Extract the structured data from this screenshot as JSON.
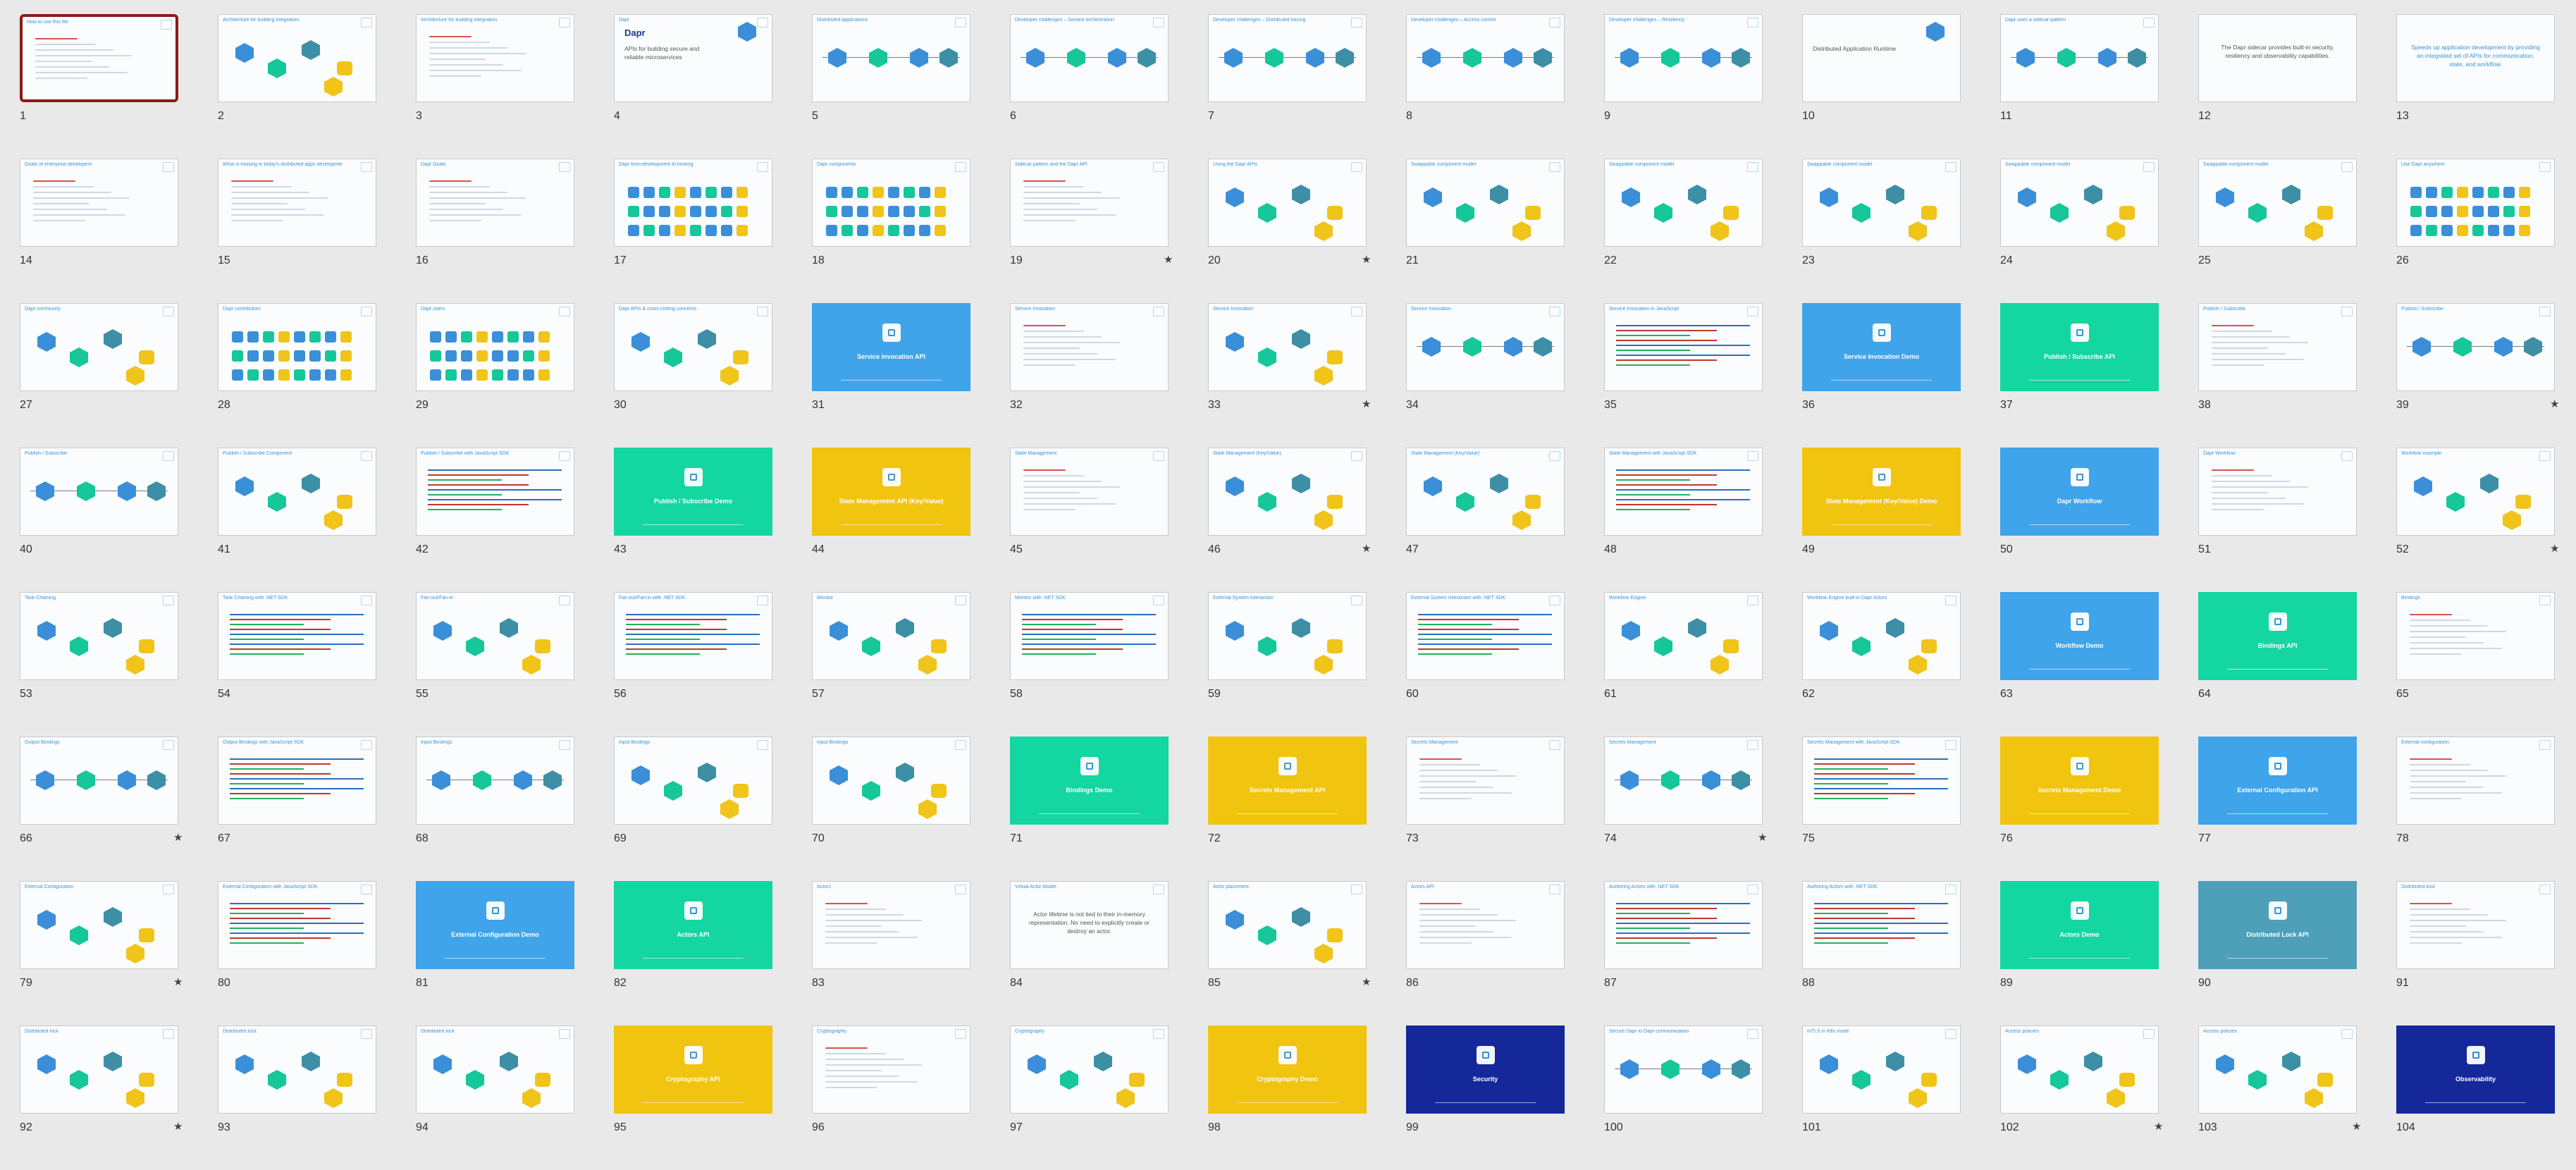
{
  "slides": [
    {
      "n": "1",
      "title": "How to use this file",
      "kind": "text",
      "selected": true,
      "star": false
    },
    {
      "n": "2",
      "title": "Architecture for building integration",
      "kind": "diagram",
      "star": false
    },
    {
      "n": "3",
      "title": "Architecture for building integration",
      "kind": "text",
      "star": false
    },
    {
      "n": "4",
      "title": "Dapr",
      "kind": "cover",
      "body": "APIs for building secure and reliable microservices",
      "star": false
    },
    {
      "n": "5",
      "title": "Distributed applications",
      "kind": "flow",
      "star": false
    },
    {
      "n": "6",
      "title": "Developer challenges – Service orchestration",
      "kind": "flow",
      "star": false
    },
    {
      "n": "7",
      "title": "Developer challenges – Distributed tracing",
      "kind": "flow",
      "star": false
    },
    {
      "n": "8",
      "title": "Developer challenges – Access control",
      "kind": "flow",
      "star": false
    },
    {
      "n": "9",
      "title": "Developer challenges – Resiliency",
      "kind": "flow",
      "star": false
    },
    {
      "n": "10",
      "title": "",
      "kind": "cover",
      "body": "Distributed Application Runtime",
      "star": false
    },
    {
      "n": "11",
      "title": "Dapr uses a sidecar pattern",
      "kind": "flow",
      "star": false
    },
    {
      "n": "12",
      "title": "",
      "kind": "center",
      "body": "The Dapr sidecar provides built-in security, resiliency and observability capabilities.",
      "star": false
    },
    {
      "n": "13",
      "title": "",
      "kind": "center-blue",
      "body": "Speeds up application development by providing an integrated set of APIs for communication, state, and workflow.",
      "star": false
    },
    {
      "n": "14",
      "title": "Goals of enterprise developers",
      "kind": "text",
      "star": false
    },
    {
      "n": "15",
      "title": "What is missing in today's distributed apps development?",
      "kind": "text",
      "star": false
    },
    {
      "n": "16",
      "title": "Dapr Goals",
      "kind": "text",
      "star": false
    },
    {
      "n": "17",
      "title": "Dapr from development to hosting",
      "kind": "grid",
      "star": false
    },
    {
      "n": "18",
      "title": "Dapr components",
      "kind": "grid",
      "star": false
    },
    {
      "n": "19",
      "title": "Sidecar pattern and the Dapr API",
      "kind": "text",
      "star": true
    },
    {
      "n": "20",
      "title": "Using the Dapr APIs",
      "kind": "diagram",
      "star": true
    },
    {
      "n": "21",
      "title": "Swappable component model",
      "kind": "diagram",
      "star": false
    },
    {
      "n": "22",
      "title": "Swappable component model",
      "kind": "diagram",
      "star": false
    },
    {
      "n": "23",
      "title": "Swappable component model",
      "kind": "diagram",
      "star": false
    },
    {
      "n": "24",
      "title": "Swappable component model",
      "kind": "diagram",
      "star": false
    },
    {
      "n": "25",
      "title": "Swappable component model",
      "kind": "diagram",
      "star": false
    },
    {
      "n": "26",
      "title": "Use Dapr anywhere",
      "kind": "grid",
      "star": false
    },
    {
      "n": "27",
      "title": "Dapr community",
      "kind": "diagram",
      "star": false
    },
    {
      "n": "28",
      "title": "Dapr contributors",
      "kind": "grid",
      "star": false
    },
    {
      "n": "29",
      "title": "Dapr users",
      "kind": "grid",
      "star": false
    },
    {
      "n": "30",
      "title": "Dapr APIs & cross-cutting concerns",
      "kind": "diagram",
      "star": false
    },
    {
      "n": "31",
      "title": "Service Invocation API",
      "kind": "section",
      "color": "blue",
      "star": false
    },
    {
      "n": "32",
      "title": "Service Invocation",
      "kind": "text",
      "star": false
    },
    {
      "n": "33",
      "title": "Service Invocation",
      "kind": "diagram",
      "star": true
    },
    {
      "n": "34",
      "title": "Service Invocation",
      "kind": "flow",
      "star": false
    },
    {
      "n": "35",
      "title": "Service Invocation in JavaScript",
      "kind": "code",
      "star": false
    },
    {
      "n": "36",
      "title": "Service Invocation Demo",
      "kind": "section",
      "color": "blue",
      "star": false
    },
    {
      "n": "37",
      "title": "Publish / Subscribe API",
      "kind": "section",
      "color": "green",
      "star": false
    },
    {
      "n": "38",
      "title": "Publish / Subscribe",
      "kind": "text",
      "star": false
    },
    {
      "n": "39",
      "title": "Publish / Subscribe",
      "kind": "flow",
      "star": true
    },
    {
      "n": "40",
      "title": "Publish / Subscribe",
      "kind": "flow",
      "star": false
    },
    {
      "n": "41",
      "title": "Publish / Subscribe Component",
      "kind": "diagram",
      "star": false
    },
    {
      "n": "42",
      "title": "Publish / Subscribe with JavaScript SDK",
      "kind": "code",
      "star": false
    },
    {
      "n": "43",
      "title": "Publish / Subscribe Demo",
      "kind": "section",
      "color": "green",
      "star": false
    },
    {
      "n": "44",
      "title": "State Management API (Key/Value)",
      "kind": "section",
      "color": "yellow",
      "star": false
    },
    {
      "n": "45",
      "title": "State Management",
      "kind": "text",
      "star": false
    },
    {
      "n": "46",
      "title": "State Management (Key/Value)",
      "kind": "diagram",
      "star": true
    },
    {
      "n": "47",
      "title": "State Management (Key/Value)",
      "kind": "diagram",
      "star": false
    },
    {
      "n": "48",
      "title": "State Management with JavaScript SDK",
      "kind": "code",
      "star": false
    },
    {
      "n": "49",
      "title": "State Management (Key/Value) Demo",
      "kind": "section",
      "color": "yellow",
      "star": false
    },
    {
      "n": "50",
      "title": "Dapr Workflow",
      "kind": "section",
      "color": "blue",
      "star": false
    },
    {
      "n": "51",
      "title": "Dapr Workflow",
      "kind": "text",
      "star": false
    },
    {
      "n": "52",
      "title": "Workflow example",
      "kind": "diagram",
      "star": true
    },
    {
      "n": "53",
      "title": "Task Chaining",
      "kind": "diagram",
      "star": false
    },
    {
      "n": "54",
      "title": "Task Chaining with .NET SDK",
      "kind": "code",
      "star": false
    },
    {
      "n": "55",
      "title": "Fan-out/Fan-in",
      "kind": "diagram",
      "star": false
    },
    {
      "n": "56",
      "title": "Fan-out/Fan-in with .NET SDK",
      "kind": "code",
      "star": false
    },
    {
      "n": "57",
      "title": "Monitor",
      "kind": "diagram",
      "star": false
    },
    {
      "n": "58",
      "title": "Monitor with .NET SDK",
      "kind": "code",
      "star": false
    },
    {
      "n": "59",
      "title": "External System Interaction",
      "kind": "diagram",
      "star": false
    },
    {
      "n": "60",
      "title": "External System Interaction with .NET SDK",
      "kind": "code",
      "star": false
    },
    {
      "n": "61",
      "title": "Workflow Engine",
      "kind": "diagram",
      "star": false
    },
    {
      "n": "62",
      "title": "Workflow Engine built-in Dapr Actors",
      "kind": "diagram",
      "star": false
    },
    {
      "n": "63",
      "title": "Workflow Demo",
      "kind": "section",
      "color": "blue",
      "star": false
    },
    {
      "n": "64",
      "title": "Bindings API",
      "kind": "section",
      "color": "green",
      "star": false
    },
    {
      "n": "65",
      "title": "Bindings",
      "kind": "text",
      "star": false
    },
    {
      "n": "66",
      "title": "Output Bindings",
      "kind": "flow",
      "star": true
    },
    {
      "n": "67",
      "title": "Output Bindings with JavaScript SDK",
      "kind": "code",
      "star": false
    },
    {
      "n": "68",
      "title": "Input Bindings",
      "kind": "flow",
      "star": false
    },
    {
      "n": "69",
      "title": "Input Bindings",
      "kind": "diagram",
      "star": false
    },
    {
      "n": "70",
      "title": "Input Bindings",
      "kind": "diagram",
      "star": false
    },
    {
      "n": "71",
      "title": "Bindings Demo",
      "kind": "section",
      "color": "green",
      "star": false
    },
    {
      "n": "72",
      "title": "Secrets Management API",
      "kind": "section",
      "color": "yellow",
      "star": false
    },
    {
      "n": "73",
      "title": "Secrets Management",
      "kind": "text",
      "star": false
    },
    {
      "n": "74",
      "title": "Secrets Management",
      "kind": "flow",
      "star": true
    },
    {
      "n": "75",
      "title": "Secrets Management with JavaScript SDK",
      "kind": "code",
      "star": false
    },
    {
      "n": "76",
      "title": "Secrets Management Demo",
      "kind": "section",
      "color": "yellow",
      "star": false
    },
    {
      "n": "77",
      "title": "External Configuration API",
      "kind": "section",
      "color": "blue",
      "star": false
    },
    {
      "n": "78",
      "title": "External configuration",
      "kind": "text",
      "star": false
    },
    {
      "n": "79",
      "title": "External Configuration",
      "kind": "diagram",
      "star": true
    },
    {
      "n": "80",
      "title": "External Configuration with JavaScript SDK",
      "kind": "code",
      "star": false
    },
    {
      "n": "81",
      "title": "External Configuration Demo",
      "kind": "section",
      "color": "blue",
      "star": false
    },
    {
      "n": "82",
      "title": "Actors API",
      "kind": "section",
      "color": "green",
      "star": false
    },
    {
      "n": "83",
      "title": "Actors",
      "kind": "text",
      "star": false
    },
    {
      "n": "84",
      "title": "Virtual Actor Model",
      "kind": "center",
      "body": "Actor lifetime is not tied to their in-memory representation. No need to explicitly create or destroy an actor.",
      "star": false
    },
    {
      "n": "85",
      "title": "Actor placement",
      "kind": "diagram",
      "star": true
    },
    {
      "n": "86",
      "title": "Actors API",
      "kind": "text",
      "star": false
    },
    {
      "n": "87",
      "title": "Authoring Actors with .NET SDK",
      "kind": "code",
      "star": false
    },
    {
      "n": "88",
      "title": "Authoring Actors with .NET SDK",
      "kind": "code",
      "star": false
    },
    {
      "n": "89",
      "title": "Actors Demo",
      "kind": "section",
      "color": "green",
      "star": false
    },
    {
      "n": "90",
      "title": "Distributed Lock API",
      "kind": "section",
      "color": "teal",
      "star": false
    },
    {
      "n": "91",
      "title": "Distributed lock",
      "kind": "text",
      "star": false
    },
    {
      "n": "92",
      "title": "Distributed lock",
      "kind": "diagram",
      "star": true
    },
    {
      "n": "93",
      "title": "Distributed lock",
      "kind": "diagram",
      "star": false
    },
    {
      "n": "94",
      "title": "Distributed lock",
      "kind": "diagram",
      "star": false
    },
    {
      "n": "95",
      "title": "Cryptography API",
      "kind": "section",
      "color": "yellow",
      "star": false
    },
    {
      "n": "96",
      "title": "Cryptography",
      "kind": "text",
      "star": false
    },
    {
      "n": "97",
      "title": "Cryptography",
      "kind": "diagram",
      "star": false
    },
    {
      "n": "98",
      "title": "Cryptography Demo",
      "kind": "section",
      "color": "yellow",
      "star": false
    },
    {
      "n": "99",
      "title": "Security",
      "kind": "section",
      "color": "navy",
      "star": false
    },
    {
      "n": "100",
      "title": "Secure Dapr to Dapr communication",
      "kind": "flow",
      "star": false
    },
    {
      "n": "101",
      "title": "mTLS in K8s mode",
      "kind": "diagram",
      "star": false
    },
    {
      "n": "102",
      "title": "Access policies",
      "kind": "diagram",
      "star": true
    },
    {
      "n": "103",
      "title": "Access policies",
      "kind": "diagram",
      "star": true
    },
    {
      "n": "104",
      "title": "Observability",
      "kind": "section",
      "color": "navy",
      "star": false
    }
  ],
  "star_glyph": "★",
  "colors": {
    "selected_border": "#8b1a1a",
    "accent_blue": "#3a94db",
    "section_blue": "#3fa4ea",
    "section_green": "#14d6a0",
    "section_yellow": "#f1c40f",
    "section_navy": "#14289a",
    "section_teal": "#4e9fb8"
  }
}
